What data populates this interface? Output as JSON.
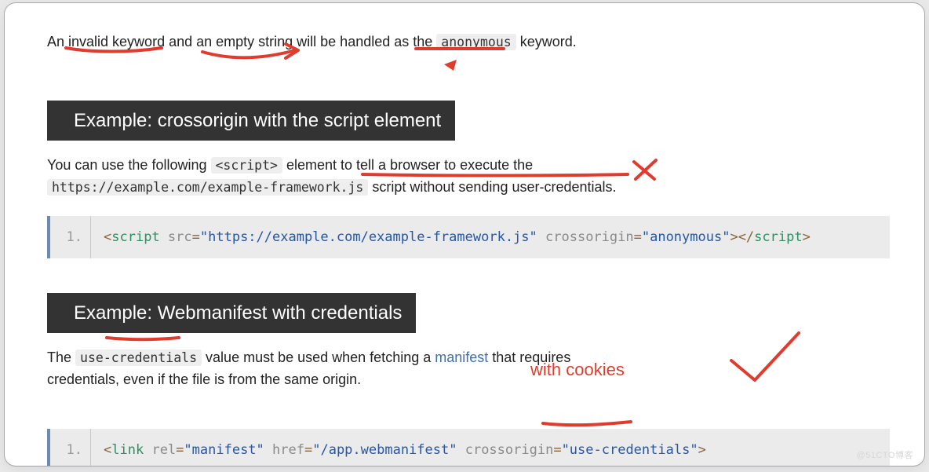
{
  "intro": {
    "text_before": "An invalid keyword and an empty string will be handled as the ",
    "code": "anonymous",
    "text_after": " keyword."
  },
  "section1": {
    "heading": "Example: crossorigin with the script element",
    "para_before": "You can use the following ",
    "para_code1": "<script>",
    "para_mid": " element to tell a browser to execute the ",
    "para_code2": "https://example.com/example-framework.js",
    "para_after": " script without sending user-credentials.",
    "code": {
      "line_no": "1.",
      "tag_open": "script",
      "attr1_name": "src",
      "attr1_value": "\"https://example.com/example-framework.js\"",
      "attr2_name": "crossorigin",
      "attr2_value": "\"anonymous\"",
      "tag_close": "script"
    }
  },
  "section2": {
    "heading": "Example: Webmanifest with credentials",
    "para_before": "The ",
    "para_code1": "use-credentials",
    "para_mid": " value must be used when fetching a ",
    "link_text": "manifest",
    "para_after1": " that requires credentials, even if the file is from the same origin.",
    "annotation_text": "with cookies",
    "code": {
      "line_no": "1.",
      "tag": "link",
      "attr1_name": "rel",
      "attr1_value": "\"manifest\"",
      "attr2_name": "href",
      "attr2_value": "\"/app.webmanifest\"",
      "attr3_name": "crossorigin",
      "attr3_value": "\"use-credentials\""
    }
  },
  "watermark": "@51CTO博客"
}
